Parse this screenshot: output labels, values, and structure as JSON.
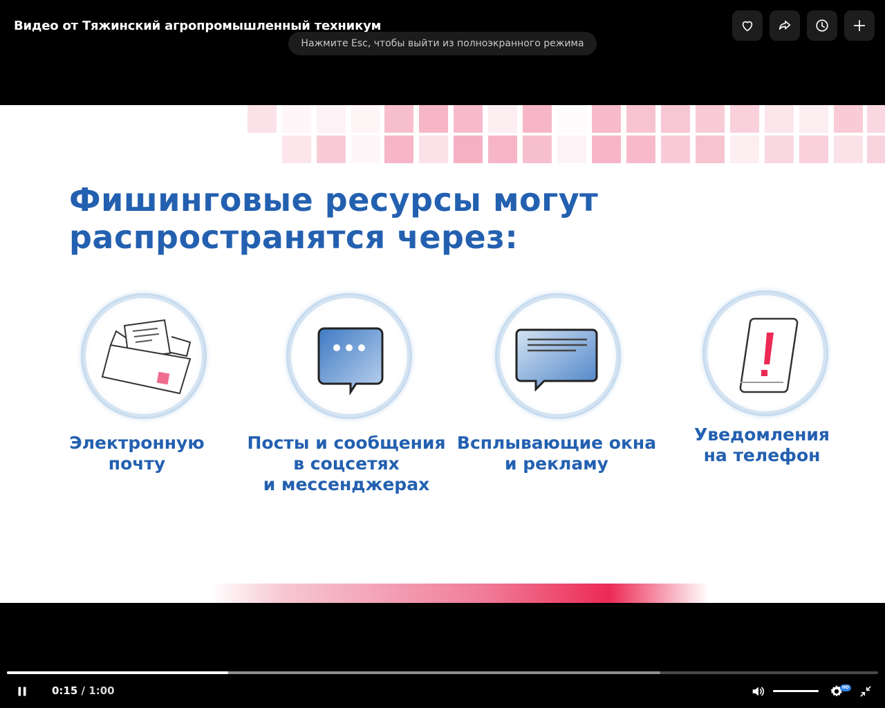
{
  "window": {
    "title": "Видео от Тяжинский агропромышленный техникум",
    "esc_hint": "Нажмите Esc, чтобы выйти из полноэкранного режима"
  },
  "top_actions": [
    {
      "name": "like-button",
      "icon": "heart-icon"
    },
    {
      "name": "share-button",
      "icon": "share-arrow-icon"
    },
    {
      "name": "watch-later-button",
      "icon": "clock-icon"
    },
    {
      "name": "add-button",
      "icon": "plus-icon"
    }
  ],
  "slide": {
    "heading_line1": "Фишинговые ресурсы могут",
    "heading_line2": "распространятся через:",
    "items": [
      {
        "icon": "envelope-icon",
        "line1": "Электронную",
        "line2": "почту",
        "line3": ""
      },
      {
        "icon": "chat-bubble-icon",
        "line1": "Посты и сообщения",
        "line2": "в соцсетях",
        "line3": "и мессенджерах"
      },
      {
        "icon": "popup-window-icon",
        "line1": "Всплывающие окна",
        "line2": "и рекламу",
        "line3": ""
      },
      {
        "icon": "phone-alert-icon",
        "line1": "Уведомления",
        "line2": "на телефон",
        "line3": ""
      }
    ]
  },
  "player": {
    "current_time": "0:15",
    "separator": "/",
    "duration": "1:00",
    "progress_fraction": 0.254,
    "buffered_fraction": 0.75,
    "volume_fraction": 1.0,
    "quality_badge": "HD"
  },
  "colors": {
    "heading_blue": "#2360b0",
    "accent_pink": "#ec2a55",
    "tile_pink": "#f4a9bd"
  }
}
